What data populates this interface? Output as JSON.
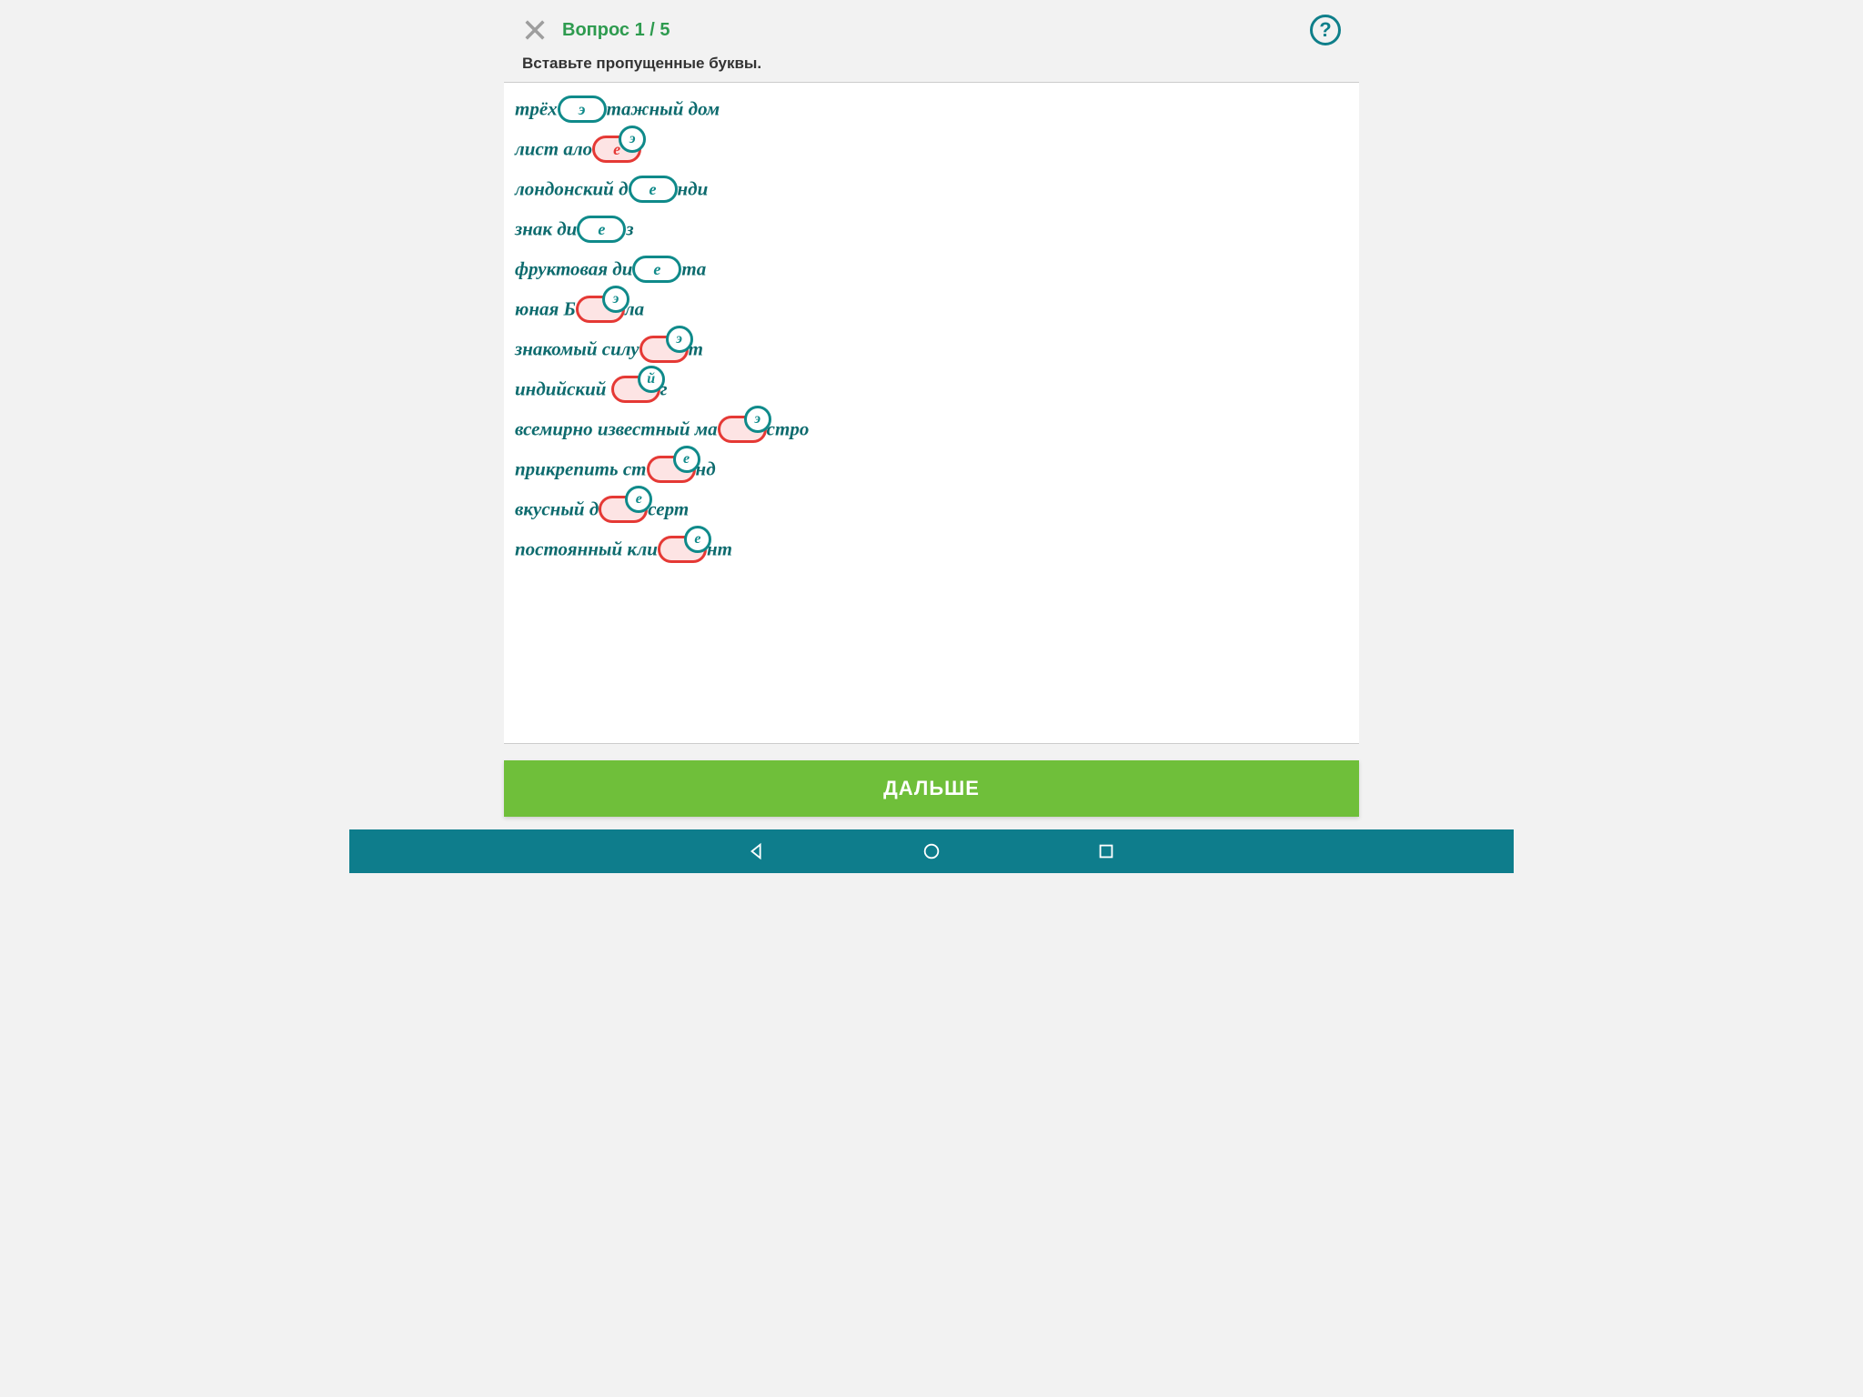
{
  "header": {
    "counter": "Вопрос 1 / 5",
    "help_label": "?"
  },
  "instruction": "Вставьте пропущенные буквы.",
  "lines": [
    {
      "pre": "трёх",
      "pill": "э",
      "state": "correct",
      "hint": null,
      "post": "тажный дом"
    },
    {
      "pre": "лист ало",
      "pill": "е",
      "state": "wrong",
      "hint": "э",
      "post": ""
    },
    {
      "pre": "лондонский д",
      "pill": "е",
      "state": "correct",
      "hint": null,
      "post": "нди"
    },
    {
      "pre": "знак ди",
      "pill": "е",
      "state": "correct",
      "hint": null,
      "post": "з"
    },
    {
      "pre": "фруктовая ди",
      "pill": "е",
      "state": "correct",
      "hint": null,
      "post": "та"
    },
    {
      "pre": "юная Б",
      "pill": "",
      "state": "wrong",
      "hint": "э",
      "post": "ла"
    },
    {
      "pre": "знакомый силу",
      "pill": "",
      "state": "wrong",
      "hint": "э",
      "post": "т"
    },
    {
      "pre": "индийский ",
      "pill": "",
      "state": "wrong",
      "hint": "й",
      "post": "г"
    },
    {
      "pre": "всемирно известный ма",
      "pill": "",
      "state": "wrong",
      "hint": "э",
      "post": "стро"
    },
    {
      "pre": "прикрепить ст",
      "pill": "",
      "state": "wrong",
      "hint": "е",
      "post": "нд"
    },
    {
      "pre": "вкусный д",
      "pill": "",
      "state": "wrong",
      "hint": "е",
      "post": "серт"
    },
    {
      "pre": "постоянный кли",
      "pill": "",
      "state": "wrong",
      "hint": "е",
      "post": "нт"
    }
  ],
  "next_label": "ДАЛЬШЕ"
}
